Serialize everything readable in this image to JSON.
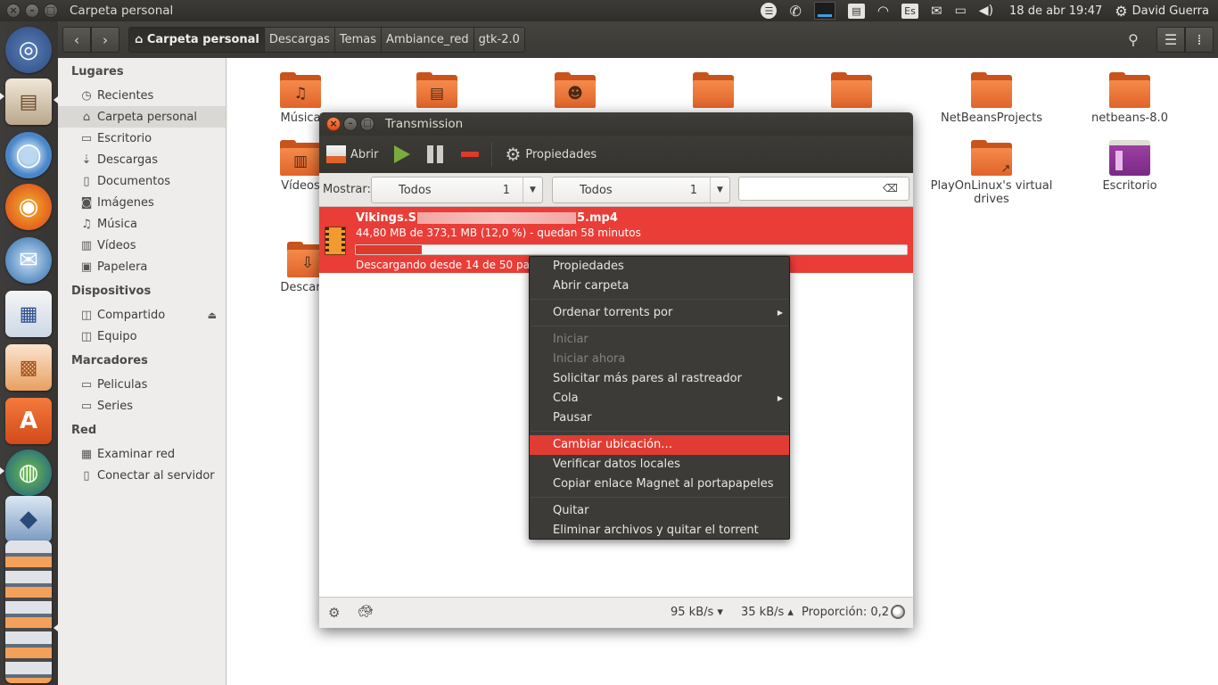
{
  "top_panel": {
    "title": "Carpeta personal",
    "keyboard_layout": "Es",
    "datetime": "18 de abr 19:47",
    "user": "David Guerra"
  },
  "launcher": {
    "icons": [
      "ubuntu-dash-icon",
      "files-icon",
      "chromium-icon",
      "firefox-icon",
      "thunderbird-icon",
      "libreoffice-impress-icon",
      "libreoffice-writer-icon",
      "software-center-icon",
      "network-icon",
      "virtualbox-icon",
      "stacked-apps-icon"
    ]
  },
  "nautilus": {
    "back": "‹",
    "forward": "›",
    "breadcrumbs": [
      "Carpeta personal",
      "Descargas",
      "Temas",
      "Ambiance_red",
      "gtk-2.0"
    ],
    "sidebar": {
      "places_heading": "Lugares",
      "places": [
        "Recientes",
        "Carpeta personal",
        "Escritorio",
        "Descargas",
        "Documentos",
        "Imágenes",
        "Música",
        "Vídeos",
        "Papelera"
      ],
      "devices_heading": "Dispositivos",
      "devices": [
        "Compartido",
        "Equipo"
      ],
      "bookmarks_heading": "Marcadores",
      "bookmarks": [
        "Peliculas",
        "Series"
      ],
      "network_heading": "Red",
      "network": [
        "Examinar red",
        "Conectar al servidor"
      ]
    },
    "files": {
      "musica": "Música",
      "videos": "Vídeos",
      "descargas": "Descarga",
      "netbeansprojects": "NetBeansProjects",
      "netbeans8": "netbeans-8.0",
      "playonlinux_1": "PlayOnLinux's virtual",
      "playonlinux_2": "drives",
      "escritorio": "Escritorio"
    }
  },
  "transmission": {
    "title": "Transmission",
    "toolbar": {
      "open": "Abrir",
      "properties": "Propiedades"
    },
    "filter": {
      "label": "Mostrar:",
      "combo1_text": "Todos",
      "combo1_count": "1",
      "combo2_text": "Todos",
      "combo2_count": "1"
    },
    "torrent": {
      "name_start": "Vikings.S",
      "name_end": "5.mp4",
      "info": "44,80 MB de 373,1 MB (12,0 %) - quedan 58 minutos",
      "progress_percent": 12.0,
      "status": "Descargando desde 14 de 50 pares"
    },
    "statusbar": {
      "down": "95 kB/s ▾",
      "up": "35 kB/s ▴",
      "ratio": "Proporción: 0,2"
    }
  },
  "context_menu": {
    "items": [
      {
        "label": "Propiedades"
      },
      {
        "label": "Abrir carpeta"
      },
      {
        "label": "Ordenar torrents por"
      },
      {
        "label": "Iniciar"
      },
      {
        "label": "Iniciar ahora"
      },
      {
        "label": "Solicitar más pares al rastreador"
      },
      {
        "label": "Cola"
      },
      {
        "label": "Pausar"
      },
      {
        "label": "Cambiar ubicación…"
      },
      {
        "label": "Verificar datos locales"
      },
      {
        "label": "Copiar enlace Magnet al portapapeles"
      },
      {
        "label": "Quitar"
      },
      {
        "label": "Eliminar archivos y quitar el torrent"
      }
    ]
  },
  "colors": {
    "accent": "#e13c33",
    "panel": "#3c3b37",
    "folder_orange": "#f07a3a"
  }
}
